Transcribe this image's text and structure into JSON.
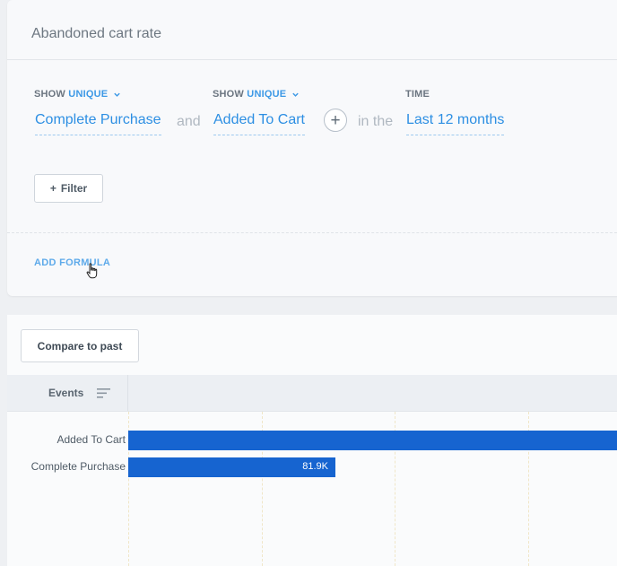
{
  "report": {
    "title": "Abandoned cart rate"
  },
  "query": {
    "measure1": {
      "prefix": "SHOW",
      "mode": "UNIQUE",
      "event": "Complete Purchase"
    },
    "joiner": "and",
    "measure2": {
      "prefix": "SHOW",
      "mode": "UNIQUE",
      "event": "Added To Cart"
    },
    "time_joiner": "in the",
    "time": {
      "label": "TIME",
      "value": "Last 12 months"
    },
    "add_measure_icon": "plus-icon"
  },
  "filter_button": {
    "label": "Filter",
    "icon": "+"
  },
  "add_formula_label": "ADD FORMULA",
  "toolbar": {
    "compare_label": "Compare to past"
  },
  "table": {
    "events_header": "Events",
    "sort_icon": "sort-lines-icon"
  },
  "colors": {
    "accent": "#2d8fe3",
    "bar": "#1664d0"
  },
  "chart_data": {
    "type": "bar",
    "orientation": "horizontal",
    "categories": [
      "Added To Cart",
      "Complete Purchase"
    ],
    "values": [
      null,
      81.9
    ],
    "value_labels": [
      "",
      "81.9K"
    ],
    "relative_length": [
      1.0,
      0.416
    ],
    "unit": "K"
  }
}
